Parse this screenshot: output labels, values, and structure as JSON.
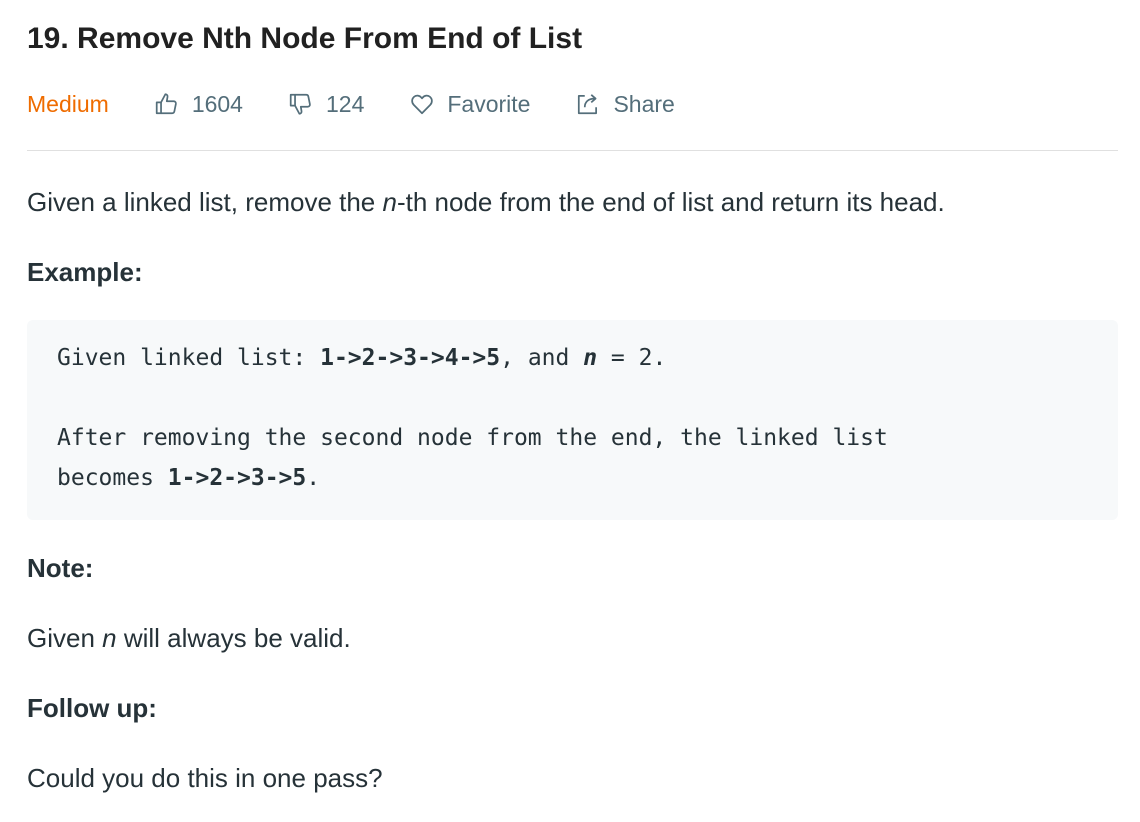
{
  "problem": {
    "title": "19. Remove Nth Node From End of List"
  },
  "meta": {
    "difficulty": "Medium",
    "likes": "1604",
    "dislikes": "124",
    "favorite_label": "Favorite",
    "share_label": "Share",
    "difficulty_color": "#ef6c00"
  },
  "description": {
    "before_n": "Given a linked list, remove the ",
    "n": "n",
    "after_n": "-th node from the end of list and return its head."
  },
  "example": {
    "heading": "Example:",
    "line1_prefix": "Given linked list: ",
    "line1_list": "1->2->3->4->5",
    "line1_mid": ", and ",
    "line1_n": "n",
    "line1_suffix": " = 2.",
    "line2": "After removing the second node from the end, the linked list",
    "line3_prefix": "becomes ",
    "line3_list": "1->2->3->5",
    "line3_suffix": "."
  },
  "note": {
    "heading": "Note:",
    "before_n": "Given ",
    "n": "n",
    "after_n": " will always be valid."
  },
  "follow_up": {
    "heading": "Follow up:",
    "text": "Could you do this in one pass?"
  }
}
